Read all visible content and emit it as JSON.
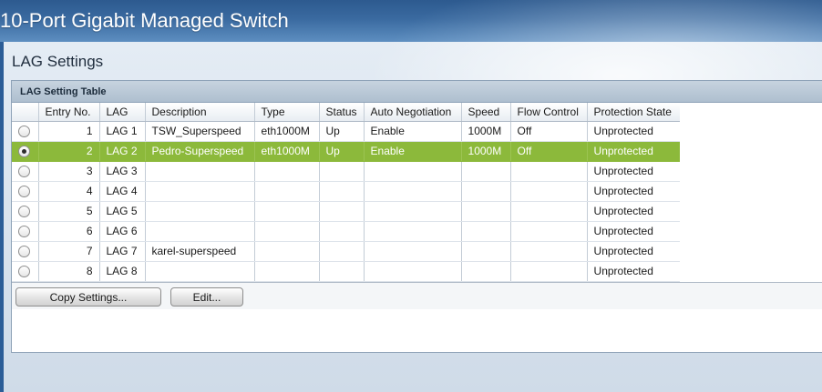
{
  "app": {
    "title": "10-Port Gigabit Managed Switch"
  },
  "page": {
    "title": "LAG Settings"
  },
  "panel": {
    "title": "LAG Setting Table"
  },
  "table": {
    "columns": [
      "",
      "Entry No.",
      "LAG",
      "Description",
      "Type",
      "Status",
      "Auto Negotiation",
      "Speed",
      "Flow Control",
      "Protection State"
    ],
    "selected_index": 1,
    "rows": [
      {
        "entry": "1",
        "lag": "LAG 1",
        "description": "TSW_Superspeed",
        "type": "eth1000M",
        "status": "Up",
        "auto_neg": "Enable",
        "speed": "1000M",
        "flow": "Off",
        "protection": "Unprotected"
      },
      {
        "entry": "2",
        "lag": "LAG 2",
        "description": "Pedro-Superspeed",
        "type": "eth1000M",
        "status": "Up",
        "auto_neg": "Enable",
        "speed": "1000M",
        "flow": "Off",
        "protection": "Unprotected"
      },
      {
        "entry": "3",
        "lag": "LAG 3",
        "description": "",
        "type": "",
        "status": "",
        "auto_neg": "",
        "speed": "",
        "flow": "",
        "protection": "Unprotected"
      },
      {
        "entry": "4",
        "lag": "LAG 4",
        "description": "",
        "type": "",
        "status": "",
        "auto_neg": "",
        "speed": "",
        "flow": "",
        "protection": "Unprotected"
      },
      {
        "entry": "5",
        "lag": "LAG 5",
        "description": "",
        "type": "",
        "status": "",
        "auto_neg": "",
        "speed": "",
        "flow": "",
        "protection": "Unprotected"
      },
      {
        "entry": "6",
        "lag": "LAG 6",
        "description": "",
        "type": "",
        "status": "",
        "auto_neg": "",
        "speed": "",
        "flow": "",
        "protection": "Unprotected"
      },
      {
        "entry": "7",
        "lag": "LAG 7",
        "description": "karel-superspeed",
        "type": "",
        "status": "",
        "auto_neg": "",
        "speed": "",
        "flow": "",
        "protection": "Unprotected"
      },
      {
        "entry": "8",
        "lag": "LAG 8",
        "description": "",
        "type": "",
        "status": "",
        "auto_neg": "",
        "speed": "",
        "flow": "",
        "protection": "Unprotected"
      }
    ]
  },
  "buttons": {
    "copy_settings": "Copy Settings...",
    "edit": "Edit..."
  },
  "colors": {
    "selected_row": "#8cb93b",
    "banner": "#3a6aa0"
  }
}
